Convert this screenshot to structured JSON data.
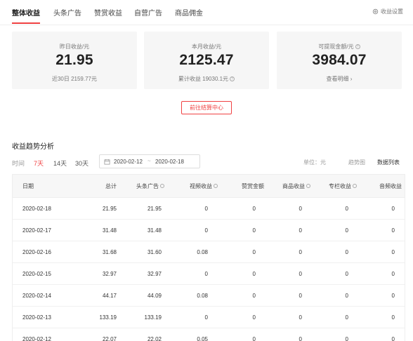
{
  "tabs": [
    {
      "label": "整体收益"
    },
    {
      "label": "头条广告"
    },
    {
      "label": "赞赏收益"
    },
    {
      "label": "自营广告"
    },
    {
      "label": "商品佣金"
    }
  ],
  "settings_label": "收益设置",
  "cards": [
    {
      "label": "昨日收益/元",
      "value": "21.95",
      "sub": "近30日 2159.77元"
    },
    {
      "label": "本月收益/元",
      "value": "2125.47",
      "sub": "累计收益 19030.1元"
    },
    {
      "label": "可提现金额/元",
      "value": "3984.07",
      "sub": "查看明细 ›"
    }
  ],
  "settle_button": "前往结算中心",
  "section_title": "收益趋势分析",
  "time_label": "时间",
  "ranges": [
    "7天",
    "14天",
    "30天"
  ],
  "date_start": "2020-02-12",
  "date_sep": "~",
  "date_end": "2020-02-18",
  "unit_label": "单位：元",
  "views": [
    "趋势图",
    "数据列表"
  ],
  "table": {
    "headers": [
      "日期",
      "总计",
      "头条广告",
      "视频收益",
      "赞赏金额",
      "商品收益",
      "专栏收益",
      "音频收益"
    ],
    "rows": [
      [
        "2020-02-18",
        "21.95",
        "21.95",
        "0",
        "0",
        "0",
        "0",
        "0"
      ],
      [
        "2020-02-17",
        "31.48",
        "31.48",
        "0",
        "0",
        "0",
        "0",
        "0"
      ],
      [
        "2020-02-16",
        "31.68",
        "31.60",
        "0.08",
        "0",
        "0",
        "0",
        "0"
      ],
      [
        "2020-02-15",
        "32.97",
        "32.97",
        "0",
        "0",
        "0",
        "0",
        "0"
      ],
      [
        "2020-02-14",
        "44.17",
        "44.09",
        "0.08",
        "0",
        "0",
        "0",
        "0"
      ],
      [
        "2020-02-13",
        "133.19",
        "133.19",
        "0",
        "0",
        "0",
        "0",
        "0"
      ],
      [
        "2020-02-12",
        "22.07",
        "22.02",
        "0.05",
        "0",
        "0",
        "0",
        "0"
      ]
    ]
  }
}
